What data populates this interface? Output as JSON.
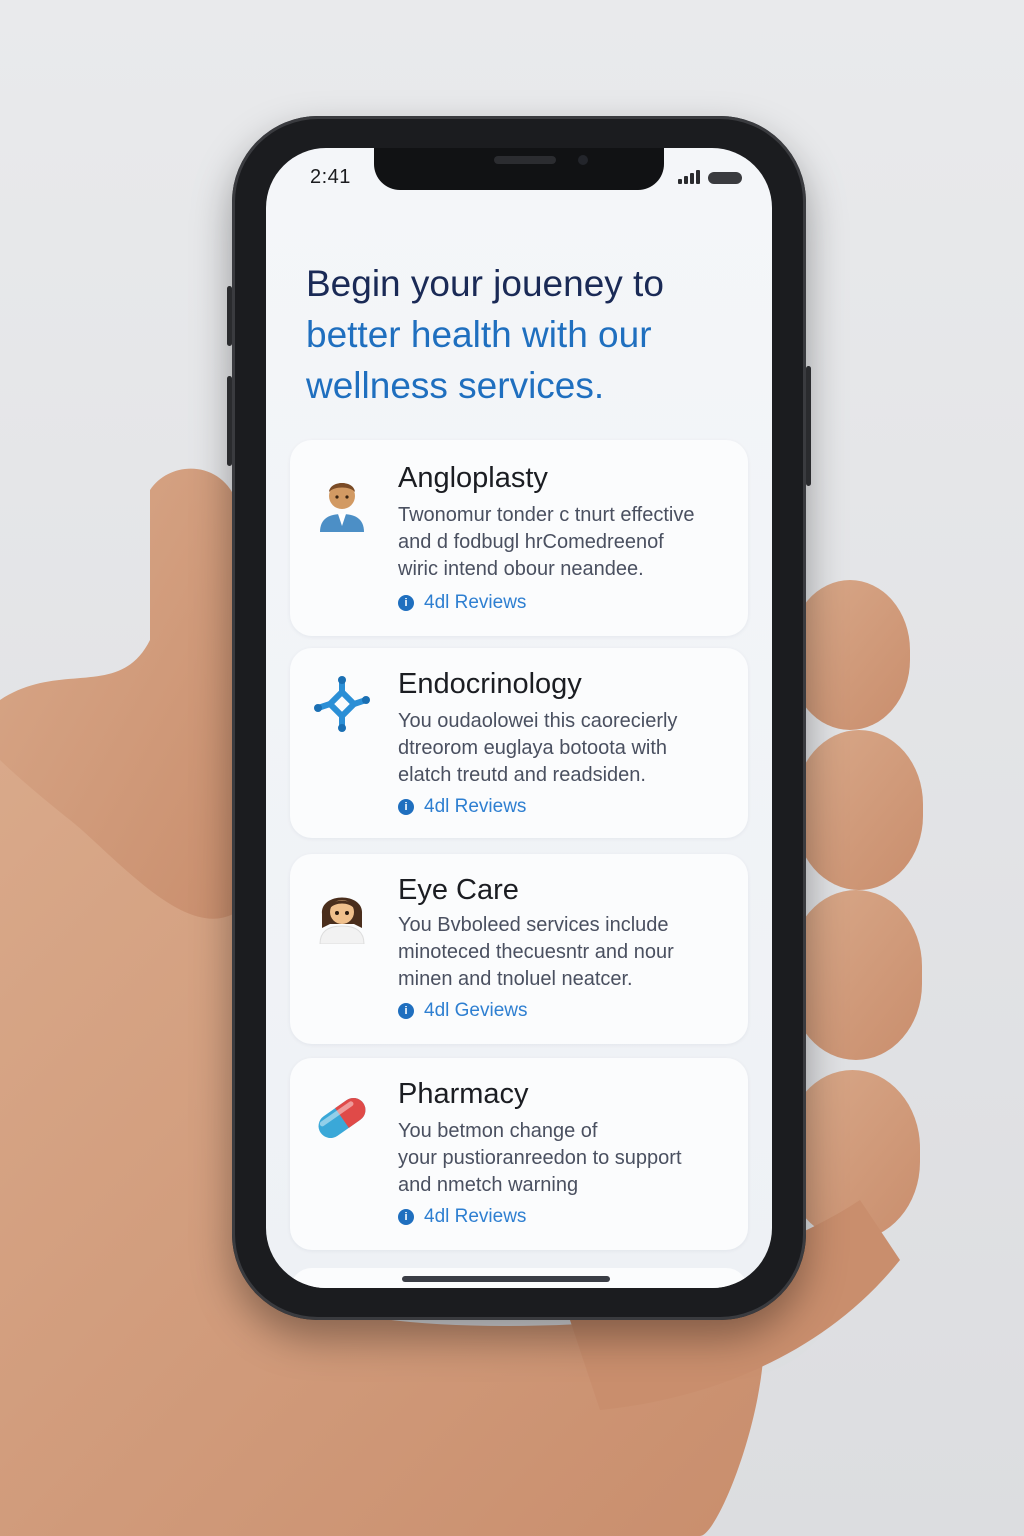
{
  "status_bar": {
    "time": "2:41"
  },
  "headline": {
    "line1": "Begin your jouеney to",
    "line2": "better health with our",
    "line3": "wellness services."
  },
  "services": [
    {
      "title": "Angloplasty",
      "desc": [
        "Twonomur tonder c tnurt effective",
        "and d fodbugl hrComedreenof",
        "wiric intend obour neandee."
      ],
      "reviews": "4dl Reviews",
      "icon": "doctor-avatar-icon"
    },
    {
      "title": "Endocrinology",
      "desc": [
        "You oudaolowei this caorecierly",
        "dtreorom euglaya botoota with",
        "elatch treutd and readsiden."
      ],
      "reviews": "4dl Reviews",
      "icon": "molecule-icon"
    },
    {
      "title": "Eye Care",
      "desc": [
        "You Bvboleed services include",
        "minoteced thecuesntr and nour",
        "minen and tnoluel neatcer."
      ],
      "reviews": "4dl Geviews",
      "icon": "patient-avatar-icon"
    },
    {
      "title": "Pharmacy",
      "desc": [
        "You betmon change of",
        "your pustioranreedon to support",
        "and nmetch warning"
      ],
      "reviews": "4dl Reviews",
      "icon": "pill-capsule-icon"
    }
  ],
  "colors": {
    "headline_dark": "#1a2a56",
    "headline_blue": "#1f6fbf",
    "review_blue": "#2e7fd1"
  }
}
